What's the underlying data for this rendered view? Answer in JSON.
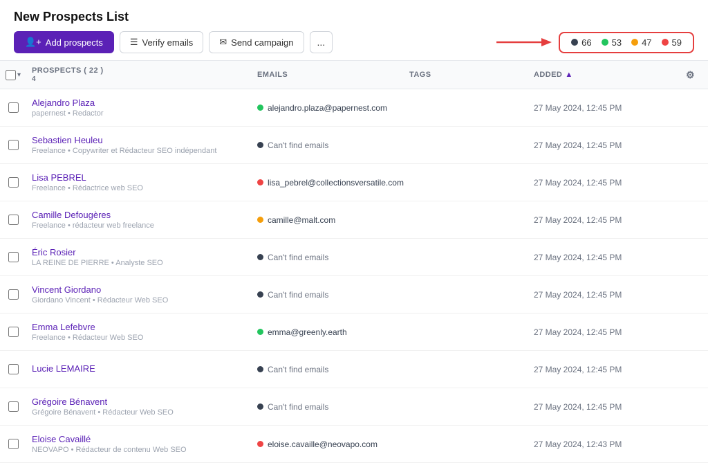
{
  "page": {
    "title": "New Prospects List"
  },
  "toolbar": {
    "add_prospects": "Add prospects",
    "verify_emails": "Verify emails",
    "send_campaign": "Send campaign",
    "more": "..."
  },
  "stats": {
    "dark": {
      "count": "66",
      "color": "#374151"
    },
    "green": {
      "count": "53",
      "color": "#22c55e"
    },
    "yellow": {
      "count": "47",
      "color": "#f59e0b"
    },
    "red": {
      "count": "59",
      "color": "#ef4444"
    }
  },
  "table": {
    "columns": {
      "prospects": "PROSPECTS ( 22 )",
      "prospects_sub": "4",
      "emails": "EMAILS",
      "tags": "TAGS",
      "added": "ADDED"
    },
    "rows": [
      {
        "name": "Alejandro Plaza",
        "company": "papernest",
        "role": "Redactor",
        "email": "alejandro.plaza@papernest.com",
        "email_status": "green",
        "tags": "",
        "added": "27 May 2024, 12:45 PM"
      },
      {
        "name": "Sebastien Heuleu",
        "company": "Freelance",
        "role": "Copywriter et Rédacteur SEO indépendant",
        "email": "Can't find emails",
        "email_status": "dark",
        "tags": "",
        "added": "27 May 2024, 12:45 PM"
      },
      {
        "name": "Lisa PEBREL",
        "company": "Freelance",
        "role": "Rédactrice web SEO",
        "email": "lisa_pebrel@collectionsversatile.com",
        "email_status": "red",
        "tags": "",
        "added": "27 May 2024, 12:45 PM"
      },
      {
        "name": "Camille Defougères",
        "company": "Freelance",
        "role": "rédacteur web freelance",
        "email": "camille@malt.com",
        "email_status": "yellow",
        "tags": "",
        "added": "27 May 2024, 12:45 PM"
      },
      {
        "name": "Éric Rosier",
        "company": "LA REINE DE PIERRE",
        "role": "Analyste SEO",
        "email": "Can't find emails",
        "email_status": "dark",
        "tags": "",
        "added": "27 May 2024, 12:45 PM"
      },
      {
        "name": "Vincent Giordano",
        "company": "Giordano Vincent",
        "role": "Rédacteur Web SEO",
        "email": "Can't find emails",
        "email_status": "dark",
        "tags": "",
        "added": "27 May 2024, 12:45 PM"
      },
      {
        "name": "Emma Lefebvre",
        "company": "Freelance",
        "role": "Rédacteur Web SEO",
        "email": "emma@greenly.earth",
        "email_status": "green",
        "tags": "",
        "added": "27 May 2024, 12:45 PM"
      },
      {
        "name": "Lucie LEMAIRE",
        "company": "",
        "role": "",
        "email": "Can't find emails",
        "email_status": "dark",
        "tags": "",
        "added": "27 May 2024, 12:45 PM"
      },
      {
        "name": "Grégoire Bénavent",
        "company": "Grégoire Bénavent",
        "role": "Rédacteur Web SEO",
        "email": "Can't find emails",
        "email_status": "dark",
        "tags": "",
        "added": "27 May 2024, 12:45 PM"
      },
      {
        "name": "Eloise Cavaillé",
        "company": "NEOVAPO",
        "role": "Rédacteur de contenu Web SEO",
        "email": "eloise.cavaille@neovapo.com",
        "email_status": "red",
        "tags": "",
        "added": "27 May 2024, 12:43 PM"
      }
    ]
  }
}
